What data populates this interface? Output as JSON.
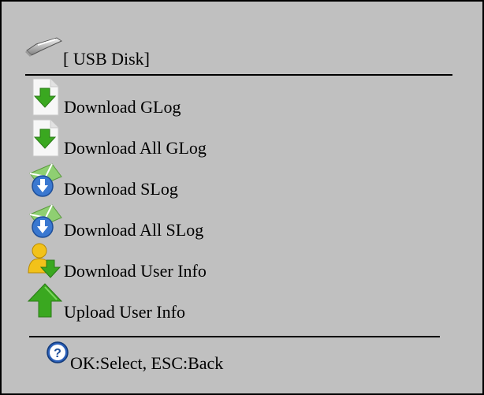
{
  "header": {
    "icon": "usb-drive-icon",
    "label": "[ USB Disk]"
  },
  "menu": {
    "items": [
      {
        "label": "Download GLog",
        "icon": "download-document-icon"
      },
      {
        "label": "Download All GLog",
        "icon": "download-document-icon"
      },
      {
        "label": "Download SLog",
        "icon": "download-mail-icon"
      },
      {
        "label": "Download All SLog",
        "icon": "download-mail-icon"
      },
      {
        "label": "Download User Info",
        "icon": "download-user-icon"
      },
      {
        "label": "Upload User Info",
        "icon": "upload-arrow-icon"
      }
    ]
  },
  "footer": {
    "icon": "help-icon",
    "hint": "OK:Select, ESC:Back"
  },
  "colors": {
    "background": "#c0c0c0",
    "arrow_green": "#3aa820",
    "disc_blue": "#3a78d0",
    "user_yellow": "#f2c21a"
  }
}
